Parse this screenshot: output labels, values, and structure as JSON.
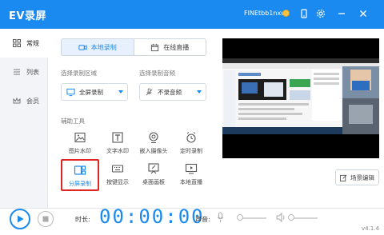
{
  "app": {
    "title": "EV录屏",
    "username": "FINEtbb1nxu"
  },
  "sidebar": {
    "items": [
      {
        "label": "常规",
        "icon": "grid-icon"
      },
      {
        "label": "列表",
        "icon": "list-icon"
      },
      {
        "label": "会员",
        "icon": "crown-icon"
      }
    ]
  },
  "tabs": {
    "local": "本地录制",
    "live": "在线直播"
  },
  "area": {
    "label": "选择录制区域",
    "value": "全屏录制"
  },
  "audio": {
    "label": "选择录制音频",
    "value": "不录音频"
  },
  "tools": {
    "label": "辅助工具",
    "items": [
      {
        "label": "图片水印",
        "icon": "image-icon"
      },
      {
        "label": "文字水印",
        "icon": "text-icon"
      },
      {
        "label": "嵌入摄像头",
        "icon": "webcam-icon"
      },
      {
        "label": "定时录制",
        "icon": "alarm-icon"
      },
      {
        "label": "分屏录制",
        "icon": "split-screen-icon"
      },
      {
        "label": "按键显示",
        "icon": "keyboard-icon"
      },
      {
        "label": "桌面画板",
        "icon": "drawing-board-icon"
      },
      {
        "label": "本地直播",
        "icon": "local-live-icon"
      }
    ]
  },
  "scene_button": "场景编辑",
  "bottom": {
    "duration_label": "时长:",
    "timer": "00:00:00",
    "volume_label": "声音:",
    "version": "v4.1.4"
  },
  "colors": {
    "accent": "#1a8af0",
    "highlight": "#e02424"
  }
}
